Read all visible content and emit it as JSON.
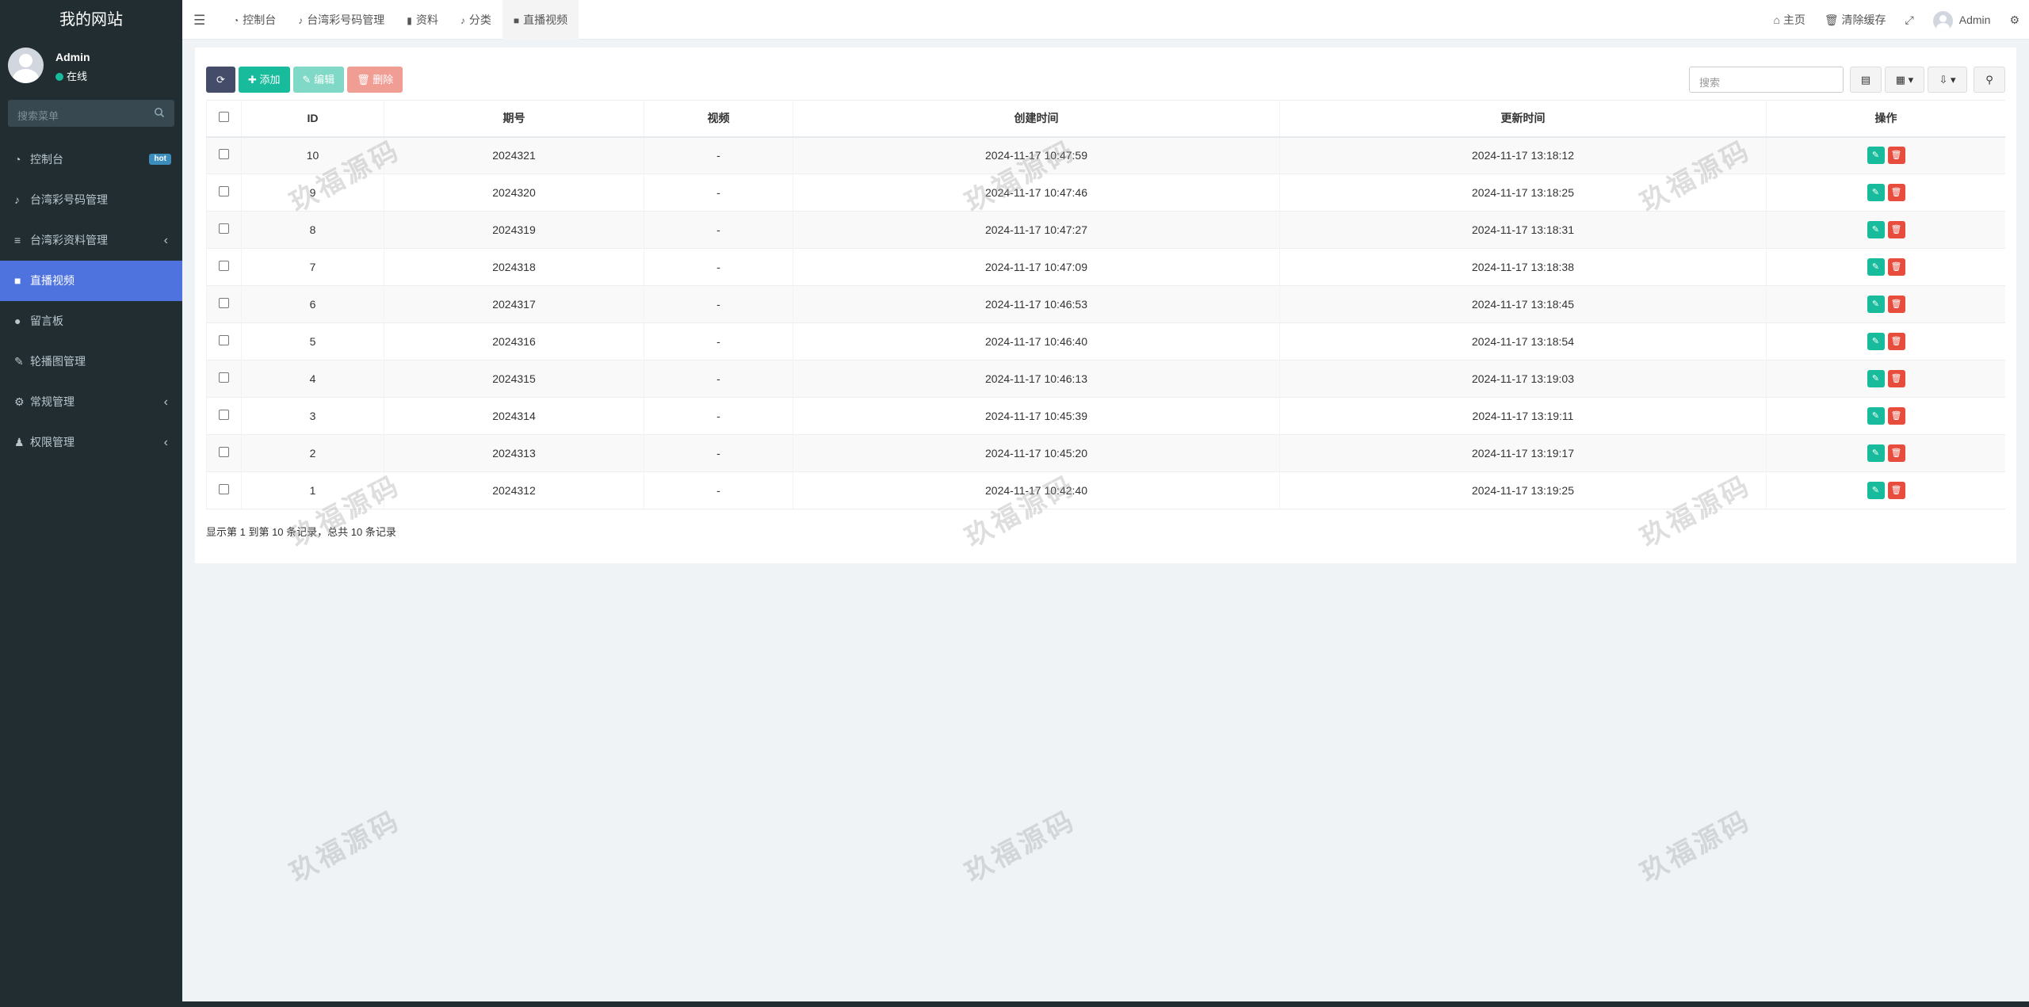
{
  "site": {
    "title": "我的网站"
  },
  "user": {
    "name": "Admin",
    "status": "在线"
  },
  "sidebar": {
    "search_placeholder": "搜索菜单",
    "items": [
      {
        "label": "控制台",
        "icon": "dashboard-icon",
        "badge": "hot"
      },
      {
        "label": "台湾彩号码管理",
        "icon": "bell-icon"
      },
      {
        "label": "台湾彩资料管理",
        "icon": "list-icon",
        "chevron": "‹"
      },
      {
        "label": "直播视频",
        "icon": "video-icon",
        "active": true
      },
      {
        "label": "留言板",
        "icon": "comment-icon"
      },
      {
        "label": "轮播图管理",
        "icon": "image-icon"
      },
      {
        "label": "常规管理",
        "icon": "cogs-icon",
        "chevron": "‹"
      },
      {
        "label": "权限管理",
        "icon": "users-icon",
        "chevron": "‹"
      }
    ]
  },
  "topbar": {
    "tabs": [
      {
        "label": "控制台",
        "icon": "dashboard-icon"
      },
      {
        "label": "台湾彩号码管理",
        "icon": "bell-icon"
      },
      {
        "label": "资料",
        "icon": "bookmark-icon"
      },
      {
        "label": "分类",
        "icon": "bell-icon"
      },
      {
        "label": "直播视频",
        "icon": "video-icon",
        "active": true
      }
    ],
    "home": "主页",
    "clear_cache": "清除缓存",
    "admin": "Admin"
  },
  "toolbar": {
    "add": "添加",
    "edit": "编辑",
    "delete": "删除",
    "search_placeholder": "搜索"
  },
  "table": {
    "headers": [
      "ID",
      "期号",
      "视频",
      "创建时间",
      "更新时间",
      "操作"
    ],
    "rows": [
      {
        "id": "10",
        "period": "2024321",
        "video": "-",
        "created": "2024-11-17 10:47:59",
        "updated": "2024-11-17 13:18:12"
      },
      {
        "id": "9",
        "period": "2024320",
        "video": "-",
        "created": "2024-11-17 10:47:46",
        "updated": "2024-11-17 13:18:25"
      },
      {
        "id": "8",
        "period": "2024319",
        "video": "-",
        "created": "2024-11-17 10:47:27",
        "updated": "2024-11-17 13:18:31"
      },
      {
        "id": "7",
        "period": "2024318",
        "video": "-",
        "created": "2024-11-17 10:47:09",
        "updated": "2024-11-17 13:18:38"
      },
      {
        "id": "6",
        "period": "2024317",
        "video": "-",
        "created": "2024-11-17 10:46:53",
        "updated": "2024-11-17 13:18:45"
      },
      {
        "id": "5",
        "period": "2024316",
        "video": "-",
        "created": "2024-11-17 10:46:40",
        "updated": "2024-11-17 13:18:54"
      },
      {
        "id": "4",
        "period": "2024315",
        "video": "-",
        "created": "2024-11-17 10:46:13",
        "updated": "2024-11-17 13:19:03"
      },
      {
        "id": "3",
        "period": "2024314",
        "video": "-",
        "created": "2024-11-17 10:45:39",
        "updated": "2024-11-17 13:19:11"
      },
      {
        "id": "2",
        "period": "2024313",
        "video": "-",
        "created": "2024-11-17 10:45:20",
        "updated": "2024-11-17 13:19:17"
      },
      {
        "id": "1",
        "period": "2024312",
        "video": "-",
        "created": "2024-11-17 10:42:40",
        "updated": "2024-11-17 13:19:25"
      }
    ],
    "summary": "显示第 1 到第 10 条记录，总共 10 条记录"
  },
  "watermark": "玖福源码",
  "colors": {
    "sidebar_bg": "#222d32",
    "active": "#4e73df",
    "green": "#18bc9c",
    "red": "#e74c3c"
  }
}
